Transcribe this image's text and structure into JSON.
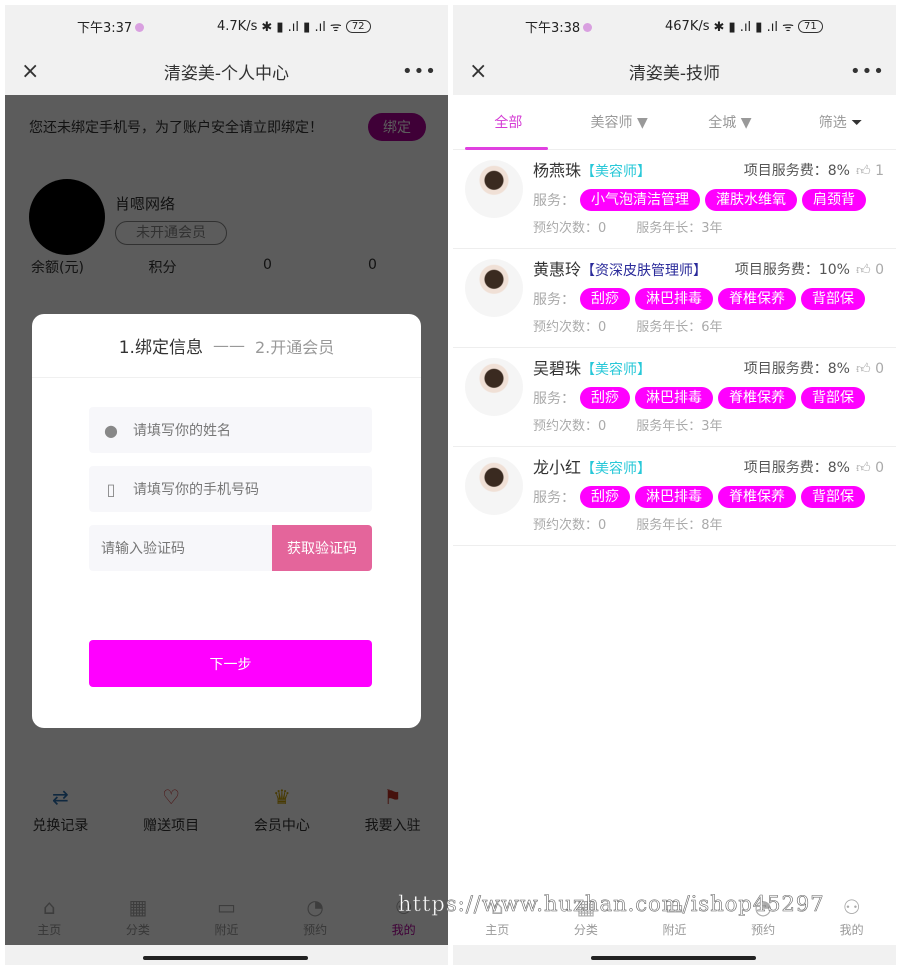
{
  "left": {
    "status": {
      "time": "下午3:37",
      "speed": "4.7K/s",
      "battery": "72"
    },
    "nav": {
      "title": "清姿美-个人中心",
      "close": "×",
      "more": "•••"
    },
    "banner": {
      "text": "您还未绑定手机号，为了账户安全请立即绑定！",
      "button": "绑定"
    },
    "profile": {
      "name": "肖嗯网络",
      "logo_text": "肖嗯网络",
      "badge": "未开通会员"
    },
    "stats": [
      {
        "label": "余额(元)"
      },
      {
        "label": "积分"
      },
      {
        "label": "0"
      },
      {
        "label": "0"
      }
    ],
    "quick": [
      {
        "label": "兑换记录",
        "icon": "exchange-icon",
        "color": "#2a6fb0"
      },
      {
        "label": "赠送项目",
        "icon": "gift-hand-icon",
        "color": "#d03030"
      },
      {
        "label": "会员中心",
        "icon": "crown-icon",
        "color": "#c8a000"
      },
      {
        "label": "我要入驻",
        "icon": "flag-icon",
        "color": "#c03020"
      }
    ],
    "modal": {
      "step1": "1.绑定信息",
      "sep": "——",
      "step2": "2.开通会员",
      "name_placeholder": "请填写你的姓名",
      "phone_placeholder": "请填写你的手机号码",
      "code_placeholder": "请输入验证码",
      "code_button": "获取验证码",
      "next_button": "下一步"
    },
    "tabbar": [
      {
        "label": "主页",
        "icon": "home-icon"
      },
      {
        "label": "分类",
        "icon": "grid-icon"
      },
      {
        "label": "附近",
        "icon": "store-icon"
      },
      {
        "label": "预约",
        "icon": "clock-icon"
      },
      {
        "label": "我的",
        "icon": "user-icon",
        "active": true
      }
    ]
  },
  "right": {
    "status": {
      "time": "下午3:38",
      "speed": "467K/s",
      "battery": "71"
    },
    "nav": {
      "title": "清姿美-技师",
      "close": "×",
      "more": "•••"
    },
    "filters": [
      {
        "label": "全部",
        "active": true
      },
      {
        "label": "美容师 ▼"
      },
      {
        "label": "全城 ▼"
      },
      {
        "label": "筛选"
      }
    ],
    "service_label": "服务：",
    "technicians": [
      {
        "name": "杨燕珠",
        "title": "【美容师】",
        "fee": "项目服务费：8%",
        "likes": "1",
        "services": [
          "小气泡清洁管理",
          "灌肤水维氧",
          "肩颈背"
        ],
        "bookings": "预约次数：0",
        "years": "服务年长：3年"
      },
      {
        "name": "黄惠玲",
        "title": "【资深皮肤管理师】",
        "fee": "项目服务费：10%",
        "likes": "0",
        "services": [
          "刮痧",
          "淋巴排毒",
          "脊椎保养",
          "背部保"
        ],
        "bookings": "预约次数：0",
        "years": "服务年长：6年"
      },
      {
        "name": "吴碧珠",
        "title": "【美容师】",
        "fee": "项目服务费：8%",
        "likes": "0",
        "services": [
          "刮痧",
          "淋巴排毒",
          "脊椎保养",
          "背部保"
        ],
        "bookings": "预约次数：0",
        "years": "服务年长：3年"
      },
      {
        "name": "龙小红",
        "title": "【美容师】",
        "fee": "项目服务费：8%",
        "likes": "0",
        "services": [
          "刮痧",
          "淋巴排毒",
          "脊椎保养",
          "背部保"
        ],
        "bookings": "预约次数：0",
        "years": "服务年长：8年"
      }
    ],
    "tabbar": [
      {
        "label": "主页"
      },
      {
        "label": "分类"
      },
      {
        "label": "附近"
      },
      {
        "label": "预约"
      },
      {
        "label": "我的"
      }
    ]
  },
  "watermark": "https://www.huzhan.com/ishop45297",
  "colors": {
    "accent": "#ff00ff",
    "code_button": "#e4659b",
    "bind_button": "#b0009a",
    "title_cyan": "#28c8d8"
  }
}
